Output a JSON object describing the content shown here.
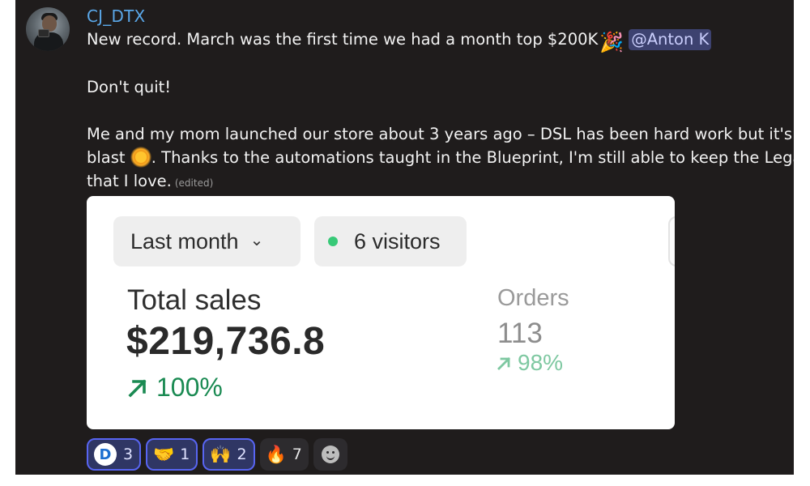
{
  "message": {
    "username": "CJ_DTX",
    "line1": "New record. March was the first time we had a month top $200K",
    "party_icon": "🎉",
    "mention": "@Anton K",
    "line2": "Don't quit!",
    "line3": "Me and my mom launched our store about 3 years ago – DSL has been hard work but it's a total",
    "line4_before": "blast",
    "line4_after": ". Thanks to the automations taught in the Blueprint, I'm still able to keep the Legal job",
    "line5": "that I love.",
    "edited": "(edited)"
  },
  "card": {
    "period_label": "Last month",
    "visitors_label": "6 visitors",
    "sales_label": "Total sales",
    "sales_value": "$219,736.8",
    "sales_change": "100%",
    "orders_label": "Orders",
    "orders_value": "113",
    "orders_change": "98%",
    "accent_green": "#1a8a52",
    "live_dot_color": "#37c977"
  },
  "reactions": [
    {
      "icon": "blueprint-logo-icon",
      "count": "3",
      "reacted": true
    },
    {
      "icon": "handshake-icon",
      "glyph": "🤝",
      "count": "1",
      "reacted": true
    },
    {
      "icon": "raised-hands-icon",
      "glyph": "🙌",
      "count": "2",
      "reacted": true
    },
    {
      "icon": "fire-icon",
      "glyph": "🔥",
      "count": "7",
      "reacted": false
    }
  ],
  "colors": {
    "background": "#1f1c1c",
    "username": "#5aa7e8",
    "mention_bg": "#3d4270",
    "reaction_active_border": "#5865f2"
  }
}
